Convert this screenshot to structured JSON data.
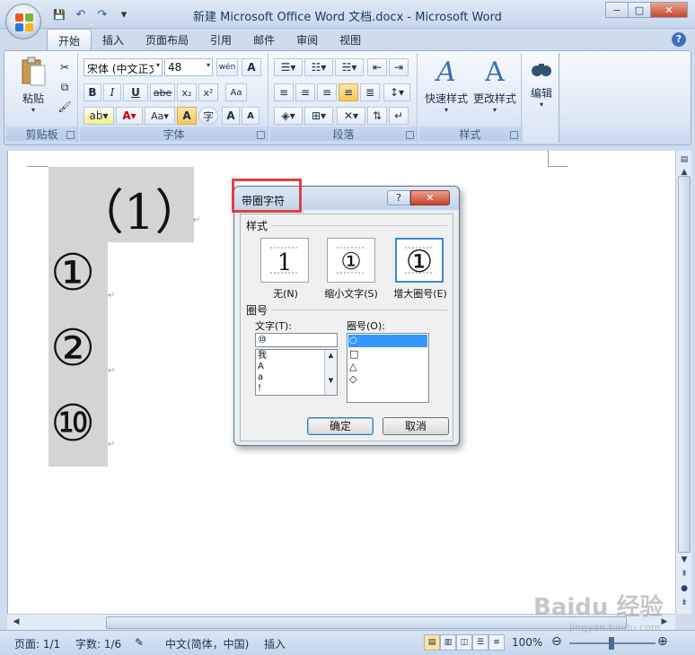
{
  "window": {
    "title": "新建 Microsoft Office Word 文档.docx - Microsoft Word",
    "minimize": "−",
    "maximize": "□",
    "close": "✕"
  },
  "qat": {
    "save": "💾",
    "undo": "↶",
    "redo": "↷",
    "customize": "▾"
  },
  "tabs": [
    "开始",
    "插入",
    "页面布局",
    "引用",
    "邮件",
    "审阅",
    "视图"
  ],
  "help": "?",
  "ribbon": {
    "clipboard": {
      "label": "剪贴板",
      "paste": "粘贴"
    },
    "font": {
      "label": "字体",
      "font_name": "宋体 (中文正文)",
      "font_size": "48",
      "bold": "B",
      "italic": "I",
      "underline": "U",
      "strike": "abe",
      "sub": "x₂",
      "sup": "x²",
      "clear": "Aa",
      "char_shade": "A",
      "enclose": "字",
      "grow": "A",
      "shrink": "A",
      "wen": "wén",
      "border": "A"
    },
    "paragraph": {
      "label": "段落"
    },
    "styles": {
      "label": "样式",
      "quick": "快速样式",
      "change": "更改样式"
    },
    "edit": {
      "label": "编辑"
    }
  },
  "document": {
    "big_char": "（1）",
    "items": [
      "①",
      "②",
      "⑩"
    ],
    "para_mark": "↵"
  },
  "status": {
    "page": "页面: 1/1",
    "words": "字数: 1/6",
    "language": "中文(简体，中国)",
    "mode": "插入",
    "zoom": "100%"
  },
  "dialog": {
    "title": "带圈字符",
    "help": "?",
    "close": "✕",
    "style_label": "样式",
    "styles": [
      {
        "glyph": "1",
        "label": "无(N)"
      },
      {
        "glyph": "①",
        "label": "缩小文字(S)"
      },
      {
        "glyph": "①",
        "label": "增大圈号(E)"
      }
    ],
    "enclose_label": "圈号",
    "text_label": "文字(T):",
    "text_value": "⑩",
    "text_options": [
      "我",
      "A",
      "a",
      "!"
    ],
    "enclosure_label": "圈号(O):",
    "enclosures": [
      "○",
      "□",
      "△",
      "◇"
    ],
    "ok": "确定",
    "cancel": "取消"
  },
  "watermark": {
    "brand": "Baidu 经验",
    "url": "jingyan.baidu.com"
  }
}
